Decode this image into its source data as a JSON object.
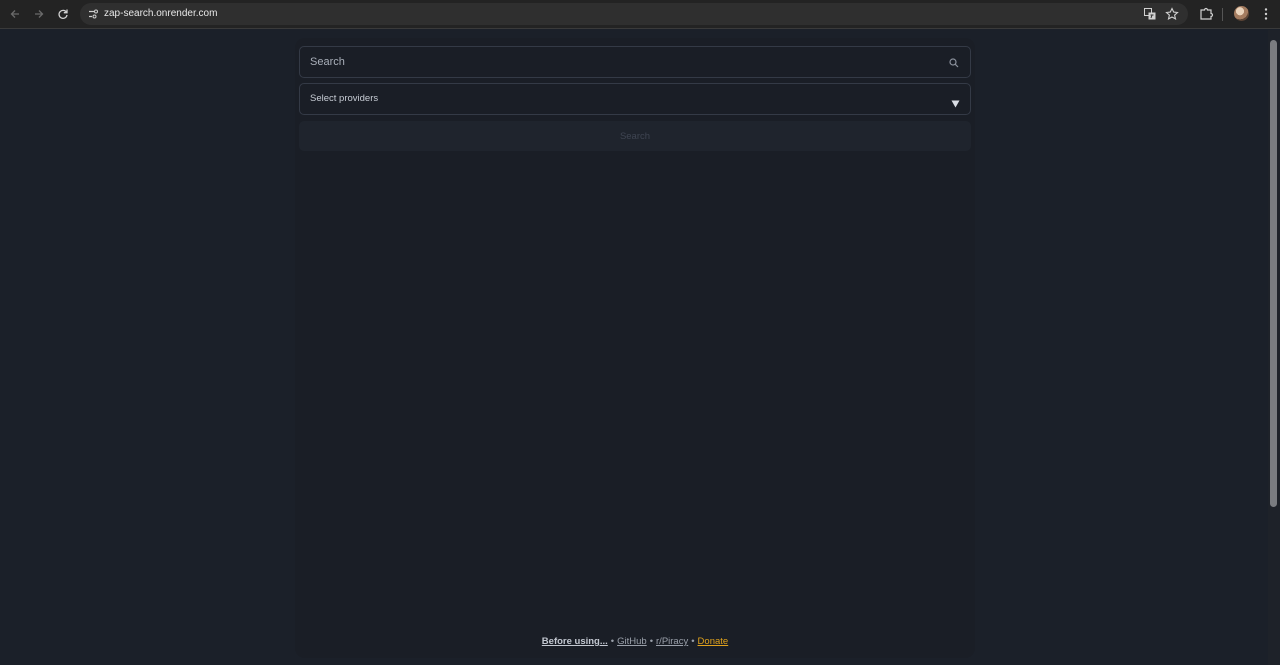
{
  "browser": {
    "url": "zap-search.onrender.com"
  },
  "search": {
    "placeholder": "Search"
  },
  "providers": {
    "label": "Select providers"
  },
  "search_button": {
    "label": "Search"
  },
  "footer": {
    "before_using": "Before using...",
    "github": "GitHub",
    "reddit": "r/Piracy",
    "donate": "Donate",
    "separator": "•"
  }
}
